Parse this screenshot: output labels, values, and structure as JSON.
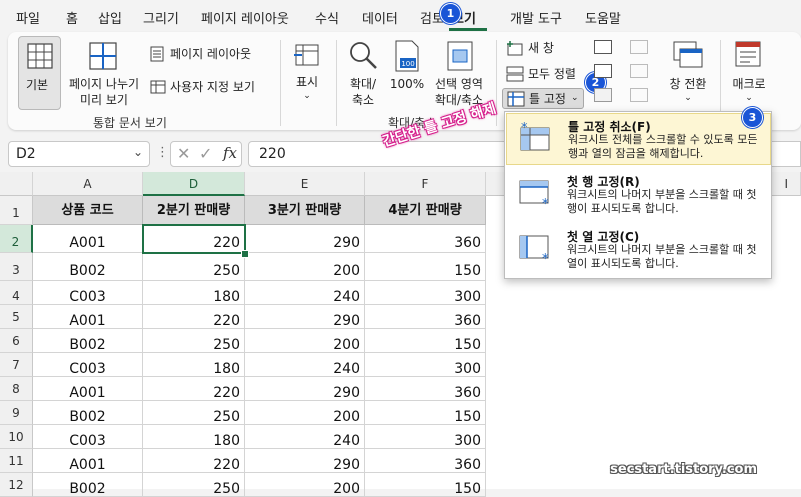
{
  "menu": {
    "tabs": [
      "파일",
      "홈",
      "삽입",
      "그리기",
      "페이지 레이아웃",
      "수식",
      "데이터",
      "검토",
      "보기",
      "개발 도구",
      "도움말"
    ],
    "active_tab": "보기"
  },
  "badges": {
    "b1": "1",
    "b2": "2",
    "b3": "3"
  },
  "ribbon": {
    "normal": "기본",
    "page_break_1": "페이지 나누기",
    "page_break_2": "미리 보기",
    "page_layout": "페이지 레이아웃",
    "custom_views": "사용자 지정 보기",
    "group_workbook_views": "통합 문서 보기",
    "show": "표시",
    "zoom_1": "확대/",
    "zoom_2": "축소",
    "zoom_100": "100%",
    "zoom_sel_1": "선택 영역",
    "zoom_sel_2": "확대/축소",
    "group_zoom": "확대/축소",
    "new_window": "새 창",
    "arrange_all": "모두 정렬",
    "freeze_panes": "틀 고정",
    "switch_windows": "창 전환",
    "macros": "매크로"
  },
  "formula_bar": {
    "name_box": "D2",
    "formula": "220",
    "fx": "fx"
  },
  "grid": {
    "columns": [
      "A",
      "D",
      "E",
      "F",
      "I"
    ],
    "rows": [
      "1",
      "2",
      "3",
      "4",
      "5",
      "6",
      "7",
      "8",
      "9",
      "10",
      "11",
      "12"
    ],
    "headers": [
      "상품 코드",
      "2분기 판매량",
      "3분기 판매량",
      "4분기 판매량"
    ],
    "data": [
      [
        "A001",
        "220",
        "290",
        "360"
      ],
      [
        "B002",
        "250",
        "200",
        "150"
      ],
      [
        "C003",
        "180",
        "240",
        "300"
      ],
      [
        "A001",
        "220",
        "290",
        "360"
      ],
      [
        "B002",
        "250",
        "200",
        "150"
      ],
      [
        "C003",
        "180",
        "240",
        "300"
      ],
      [
        "A001",
        "220",
        "290",
        "360"
      ],
      [
        "B002",
        "250",
        "200",
        "150"
      ],
      [
        "C003",
        "180",
        "240",
        "300"
      ],
      [
        "A001",
        "220",
        "290",
        "360"
      ],
      [
        "B002",
        "250",
        "200",
        "150"
      ]
    ]
  },
  "freeze_menu": {
    "items": [
      {
        "title": "틀 고정 취소(F)",
        "desc": "워크시트 전체를 스크롤할 수 있도록 모든 행과 열의 잠금을 해제합니다."
      },
      {
        "title": "첫 행 고정(R)",
        "desc": "워크시트의 나머지 부분을 스크롤할 때 첫 행이 표시되도록 합니다."
      },
      {
        "title": "첫 열 고정(C)",
        "desc": "워크시트의 나머지 부분을 스크롤할 때 첫 열이 표시되도록 합니다."
      }
    ]
  },
  "annotation": "간단한 틀 고정 해제",
  "watermark": "secstart.tistory.com"
}
